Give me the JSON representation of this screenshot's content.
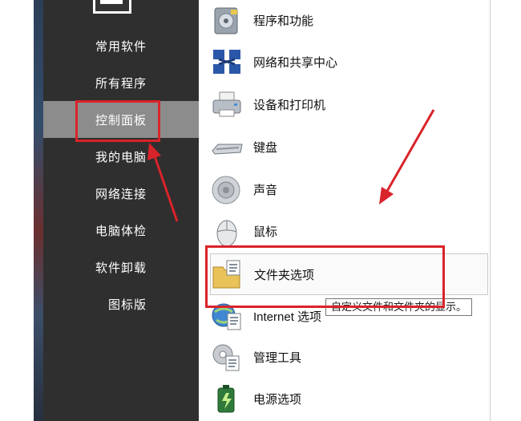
{
  "sidebar": {
    "items": [
      {
        "label": "常用软件"
      },
      {
        "label": "所有程序"
      },
      {
        "label": "控制面板"
      },
      {
        "label": "我的电脑"
      },
      {
        "label": "网络连接"
      },
      {
        "label": "电脑体检"
      },
      {
        "label": "软件卸载"
      },
      {
        "label": "图标版"
      }
    ],
    "active_index": 2
  },
  "control_panel": {
    "items": [
      {
        "label": "程序和功能",
        "icon": "programs-features-icon"
      },
      {
        "label": "网络和共享中心",
        "icon": "network-sharing-icon"
      },
      {
        "label": "设备和打印机",
        "icon": "printer-icon"
      },
      {
        "label": "键盘",
        "icon": "keyboard-icon"
      },
      {
        "label": "声音",
        "icon": "speaker-icon"
      },
      {
        "label": "鼠标",
        "icon": "mouse-icon"
      },
      {
        "label": "文件夹选项",
        "icon": "folder-options-icon"
      },
      {
        "label": "Internet 选项",
        "icon": "internet-options-icon"
      },
      {
        "label": "管理工具",
        "icon": "admin-tools-icon"
      },
      {
        "label": "电源选项",
        "icon": "power-options-icon"
      }
    ],
    "hovered_index": 6
  },
  "tooltip": {
    "text": "自定义文件和文件夹的显示。"
  },
  "colors": {
    "sidebar": "#2f2f2f",
    "active": "#8c8c8c",
    "annotation": "#d9232a"
  }
}
